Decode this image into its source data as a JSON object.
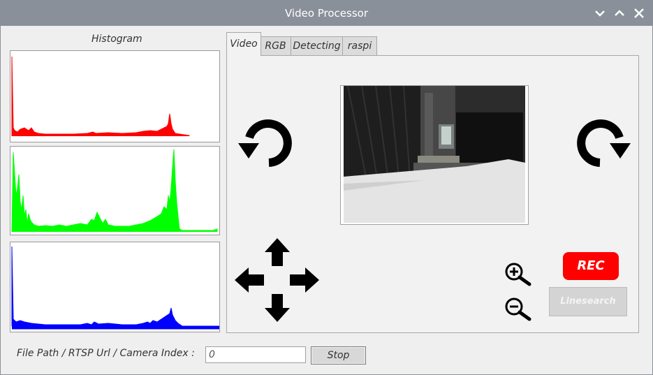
{
  "window": {
    "title": "Video Processor",
    "controls": [
      "chevron-down-icon",
      "chevron-up-icon",
      "close-icon"
    ]
  },
  "histogram": {
    "label": "Histogram",
    "channels": [
      {
        "name": "red",
        "color": "#ff0000"
      },
      {
        "name": "green",
        "color": "#00ff00"
      },
      {
        "name": "blue",
        "color": "#0000ff"
      }
    ]
  },
  "tabs": [
    {
      "label": "Video",
      "active": true
    },
    {
      "label": "RGB",
      "active": false
    },
    {
      "label": "Detecting",
      "active": false
    },
    {
      "label": "raspi",
      "active": false
    }
  ],
  "video": {
    "controls": {
      "rotate_left": "rotate-left-icon",
      "rotate_right": "rotate-right-icon",
      "arrows": [
        "arrow-up-icon",
        "arrow-left-icon",
        "arrow-right-icon",
        "arrow-down-icon"
      ],
      "zoom_in": "zoom-in-icon",
      "zoom_out": "zoom-out-icon"
    },
    "rec_label": "REC",
    "rec_color": "#ff0000",
    "linesearch_label": "Linesearch"
  },
  "source": {
    "label": "File Path / RTSP Url / Camera Index :",
    "value": "0",
    "stop_label": "Stop"
  }
}
